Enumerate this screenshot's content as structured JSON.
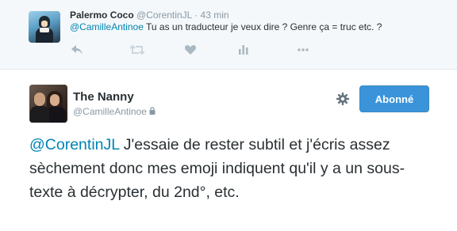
{
  "reply": {
    "avatar_alt": "Palermo Coco",
    "name": "Palermo Coco",
    "handle": "@CorentinJL",
    "dot": "·",
    "time": "43 min",
    "mention": "@CamilleAntinoe",
    "text": " Tu as un traducteur je veux dire ? Genre ça = truc etc. ?",
    "actions": [
      "reply-icon",
      "retweet-icon",
      "like-icon",
      "stats-icon",
      "more-icon"
    ]
  },
  "main": {
    "name": "The Nanny",
    "handle": "@CamilleAntinoe",
    "follow_label": "Abonné",
    "mention": "@CorentinJL",
    "text": " J'essaie de rester subtil et j'écris assez sèchement donc mes emoji indiquent qu'il y a un sous-texte à décrypter, du 2nd°, etc."
  },
  "colors": {
    "link": "#0084b4",
    "follow_button": "#3b94d9",
    "muted_text": "#8899a6",
    "reply_background": "#f5f8fa"
  }
}
